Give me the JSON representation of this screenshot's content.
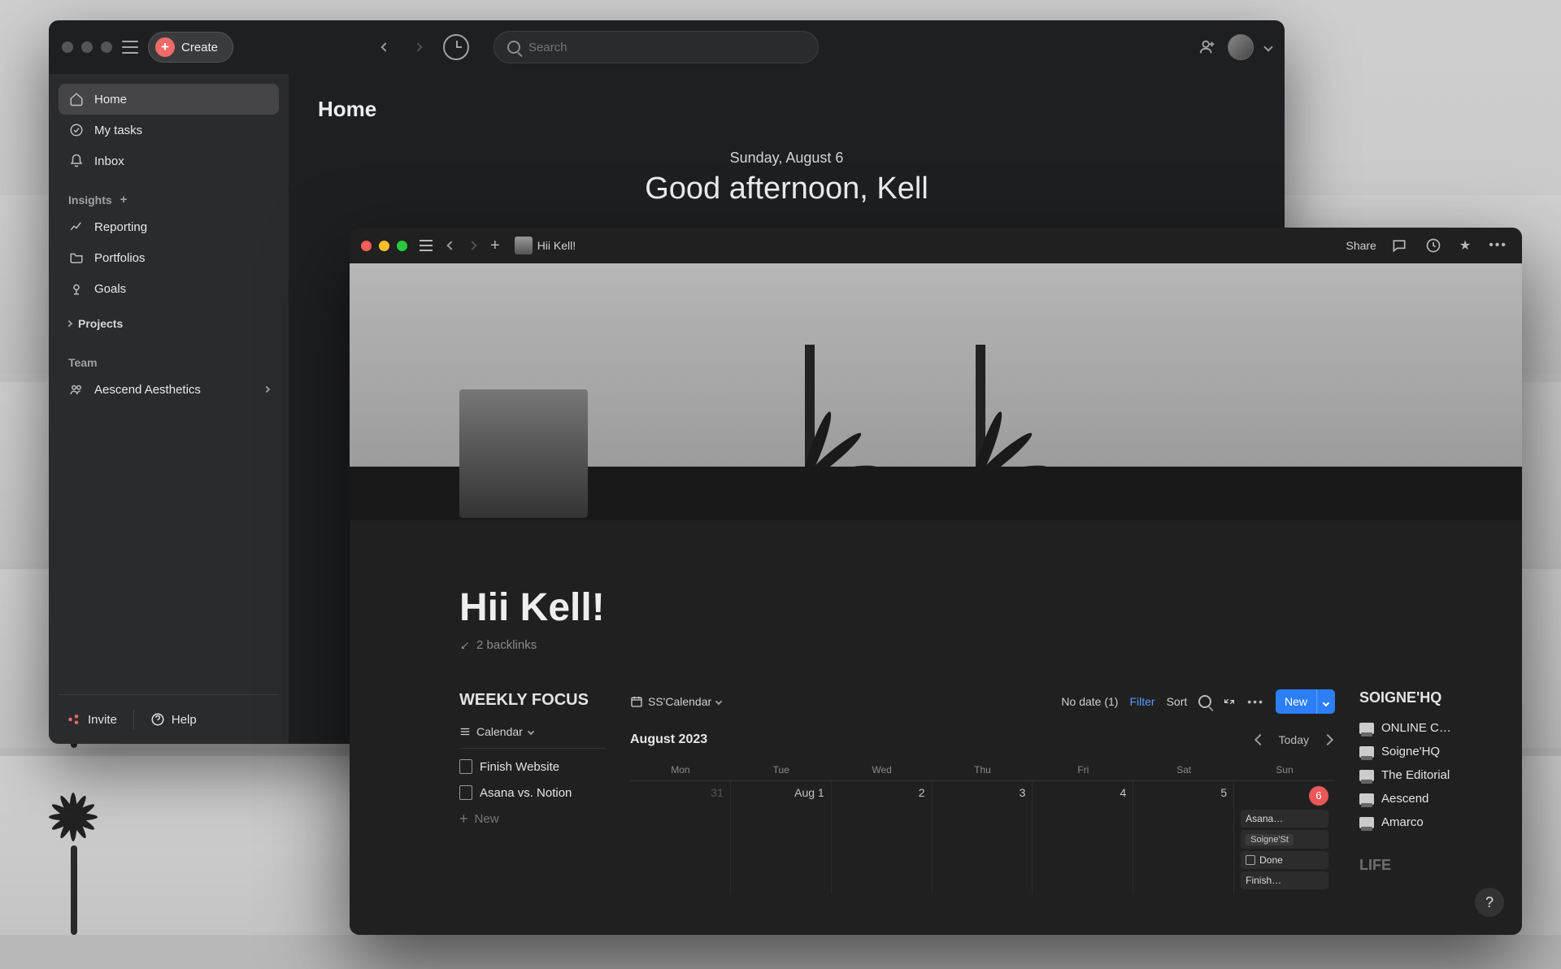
{
  "asana": {
    "create_label": "Create",
    "search_placeholder": "Search",
    "sidebar": {
      "home": "Home",
      "my_tasks": "My tasks",
      "inbox": "Inbox"
    },
    "insights": {
      "header": "Insights",
      "reporting": "Reporting",
      "portfolios": "Portfolios",
      "goals": "Goals"
    },
    "projects_header": "Projects",
    "team": {
      "header": "Team",
      "items": [
        "Aescend Aesthetics"
      ]
    },
    "footer": {
      "invite": "Invite",
      "help": "Help"
    },
    "page": {
      "title": "Home",
      "date": "Sunday, August 6",
      "greeting": "Good afternoon, Kell"
    }
  },
  "notion": {
    "breadcrumb_title": "Hii Kell!",
    "toolbar": {
      "share": "Share"
    },
    "page_title": "Hii Kell!",
    "backlinks_label": "2 backlinks",
    "weekly_focus": {
      "header": "WEEKLY FOCUS",
      "view_label": "Calendar",
      "items": [
        "Finish Website",
        "Asana vs. Notion"
      ],
      "new_label": "New"
    },
    "calendar": {
      "view_name": "SS'Calendar",
      "no_date": "No date (1)",
      "filter": "Filter",
      "sort": "Sort",
      "new_btn": "New",
      "month_label": "August 2023",
      "today_label": "Today",
      "day_headers": [
        "Mon",
        "Tue",
        "Wed",
        "Thu",
        "Fri",
        "Sat",
        "Sun"
      ],
      "dates": [
        "31",
        "Aug 1",
        "2",
        "3",
        "4",
        "5",
        "6"
      ],
      "events_sun": {
        "e1": "Asana…",
        "e2_tag": "Soigne'St",
        "e3_label": "Done",
        "e4": "Finish…"
      }
    },
    "soigne": {
      "header": "SOIGNE'HQ",
      "items": [
        "ONLINE C…",
        "Soigne'HQ",
        "The Editorial",
        "Aescend",
        "Amarco"
      ],
      "life_header": "LIFE"
    }
  }
}
